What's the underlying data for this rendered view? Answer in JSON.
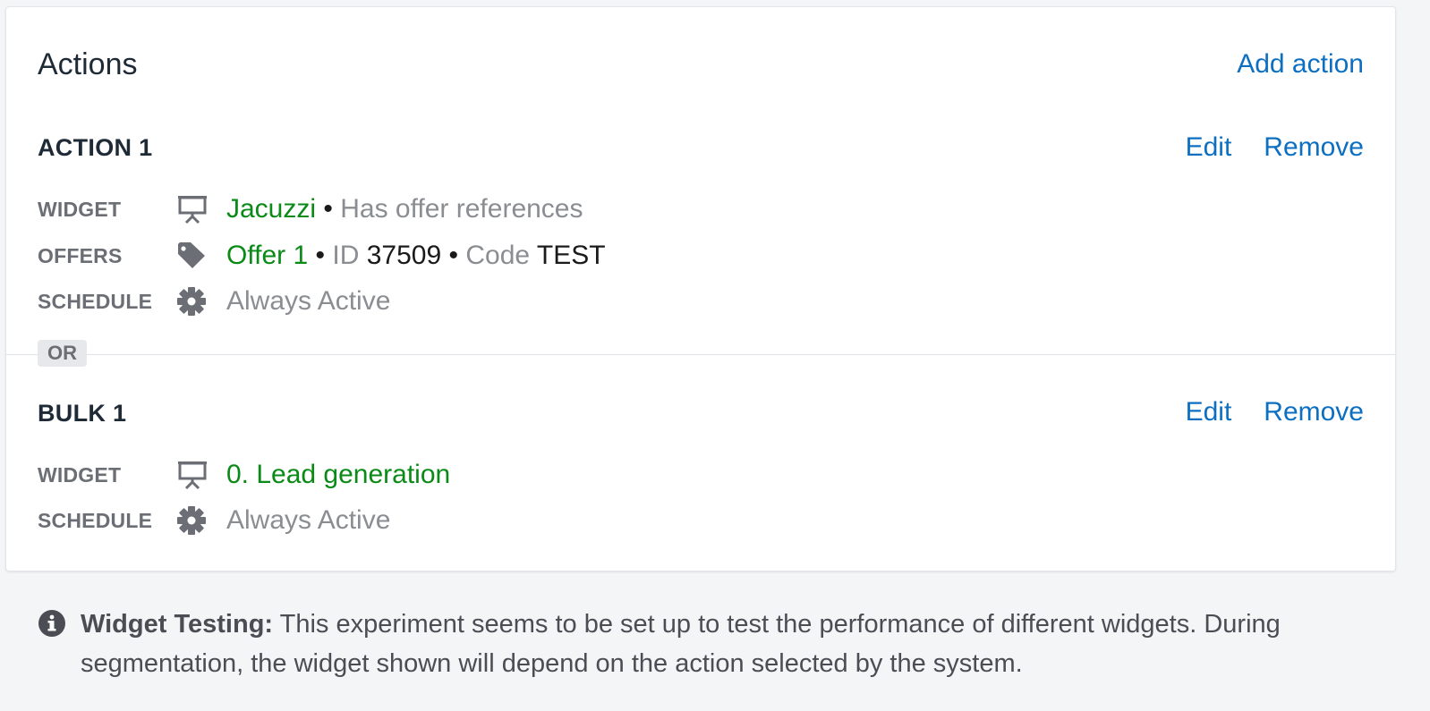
{
  "card": {
    "title": "Actions",
    "add_action_label": "Add action"
  },
  "sections": [
    {
      "title": "ACTION 1",
      "edit_label": "Edit",
      "remove_label": "Remove",
      "rows": {
        "widget": {
          "label": "WIDGET",
          "icon": "presentation-board-icon",
          "name": "Jacuzzi",
          "sep": "•",
          "detail": "Has offer references"
        },
        "offers": {
          "label": "OFFERS",
          "icon": "tag-icon",
          "name": "Offer 1",
          "sep1": "•",
          "id_label": "ID",
          "id_value": "37509",
          "sep2": "•",
          "code_label": "Code",
          "code_value": "TEST"
        },
        "schedule": {
          "label": "SCHEDULE",
          "icon": "gear-icon",
          "value": "Always Active"
        }
      }
    },
    {
      "title": "BULK 1",
      "edit_label": "Edit",
      "remove_label": "Remove",
      "rows": {
        "widget": {
          "label": "WIDGET",
          "icon": "presentation-board-icon",
          "name": "0. Lead generation"
        },
        "schedule": {
          "label": "SCHEDULE",
          "icon": "gear-icon",
          "value": "Always Active"
        }
      }
    }
  ],
  "or_label": "OR",
  "notice": {
    "icon": "info-icon",
    "title": "Widget Testing:",
    "text": "This experiment seems to be set up to test the performance of different widgets. During segmentation, the widget shown will depend on the action selected by the system."
  },
  "colors": {
    "link": "#0d6fc2",
    "green": "#0a8a16",
    "muted": "#8a8d91"
  }
}
